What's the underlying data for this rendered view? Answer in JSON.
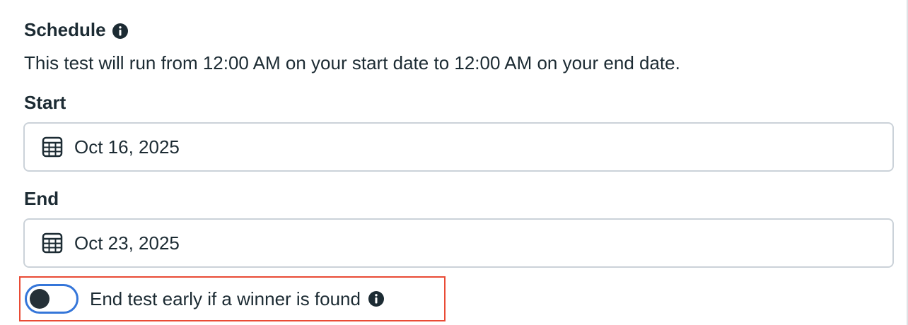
{
  "schedule": {
    "heading": "Schedule",
    "heading_icon": "info-icon",
    "description": "This test will run from 12:00 AM on your start date to 12:00 AM on your end date."
  },
  "start": {
    "label": "Start",
    "icon": "calendar-icon",
    "value": "Oct 16, 2025"
  },
  "end": {
    "label": "End",
    "icon": "calendar-icon",
    "value": "Oct 23, 2025"
  },
  "early_end": {
    "label": "End test early if a winner is found",
    "enabled": false,
    "icon": "info-icon",
    "highlight_color": "#e94b35",
    "toggle_outline_color": "#3576d9"
  }
}
